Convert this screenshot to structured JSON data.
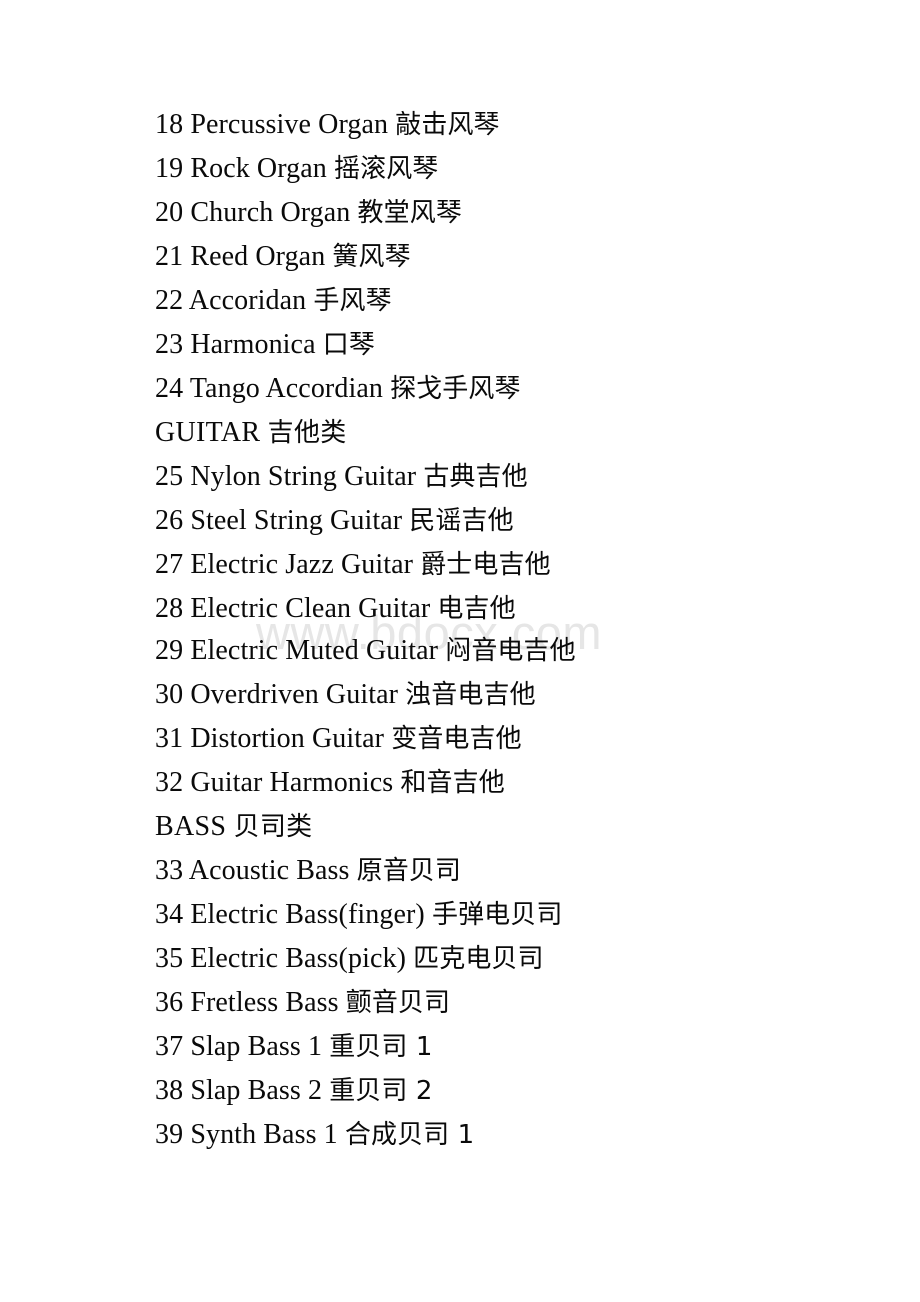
{
  "document": {
    "type": "instrument-list",
    "watermark": "www.bdocx.com",
    "watermark_color": "#e6e6e6",
    "text_color": "#0a0a0a",
    "background_color": "#ffffff",
    "lines": [
      {
        "number": "18",
        "name": "Percussive Organ",
        "cn": "敲击风琴",
        "kind": "entry"
      },
      {
        "number": "19",
        "name": "Rock Organ",
        "cn": "摇滚风琴",
        "kind": "entry"
      },
      {
        "number": "20",
        "name": "Church Organ",
        "cn": "教堂风琴",
        "kind": "entry"
      },
      {
        "number": "21",
        "name": "Reed Organ",
        "cn": "簧风琴",
        "kind": "entry"
      },
      {
        "number": "22",
        "name": "Accoridan",
        "cn": "手风琴",
        "kind": "entry"
      },
      {
        "number": "23",
        "name": "Harmonica",
        "cn": "口琴",
        "kind": "entry"
      },
      {
        "number": "24",
        "name": "Tango Accordian",
        "cn": "探戈手风琴",
        "kind": "entry"
      },
      {
        "number": "",
        "name": "GUITAR",
        "cn": "吉他类",
        "kind": "category"
      },
      {
        "number": "25",
        "name": "Nylon String Guitar",
        "cn": "古典吉他",
        "kind": "entry"
      },
      {
        "number": "26",
        "name": "Steel String Guitar",
        "cn": "民谣吉他",
        "kind": "entry"
      },
      {
        "number": "27",
        "name": "Electric Jazz Guitar",
        "cn": "爵士电吉他",
        "kind": "entry"
      },
      {
        "number": "28",
        "name": "Electric Clean Guitar",
        "cn": "电吉他",
        "kind": "entry"
      },
      {
        "number": "29",
        "name": "Electric Muted Guitar",
        "cn": "闷音电吉他",
        "kind": "entry"
      },
      {
        "number": "30",
        "name": "Overdriven Guitar",
        "cn": "浊音电吉他",
        "kind": "entry"
      },
      {
        "number": "31",
        "name": "Distortion Guitar",
        "cn": "变音电吉他",
        "kind": "entry"
      },
      {
        "number": "32",
        "name": "Guitar Harmonics",
        "cn": "和音吉他",
        "kind": "entry"
      },
      {
        "number": "",
        "name": "BASS",
        "cn": "贝司类",
        "kind": "category"
      },
      {
        "number": "33",
        "name": "Acoustic Bass",
        "cn": "原音贝司",
        "kind": "entry"
      },
      {
        "number": "34",
        "name": "Electric Bass(finger)",
        "cn": "手弹电贝司",
        "kind": "entry"
      },
      {
        "number": "35",
        "name": "Electric Bass(pick)",
        "cn": "匹克电贝司",
        "kind": "entry"
      },
      {
        "number": "36",
        "name": "Fretless Bass",
        "cn": "颤音贝司",
        "kind": "entry"
      },
      {
        "number": "37",
        "name": "Slap Bass 1",
        "cn": "重贝司 1",
        "kind": "entry"
      },
      {
        "number": "38",
        "name": "Slap Bass 2",
        "cn": "重贝司 2",
        "kind": "entry"
      },
      {
        "number": "39",
        "name": "Synth Bass 1",
        "cn": "合成贝司 1",
        "kind": "entry"
      }
    ]
  }
}
